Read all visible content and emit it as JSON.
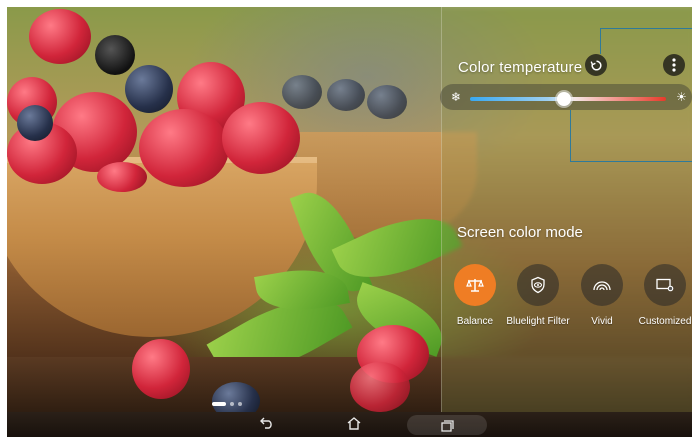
{
  "color_temperature": {
    "title": "Color temperature",
    "reset_icon": "refresh-icon",
    "menu_icon": "more-vert-icon",
    "cold_icon": "snowflake-icon",
    "warm_icon": "sun-icon",
    "slider_value": 0.48
  },
  "screen_color_mode": {
    "title": "Screen color mode",
    "modes": [
      {
        "label": "Balance",
        "icon": "scale-icon",
        "active": true
      },
      {
        "label": "Bluelight Filter",
        "icon": "eye-shield-icon",
        "active": false
      },
      {
        "label": "Vivid",
        "icon": "rainbow-icon",
        "active": false
      },
      {
        "label": "Customized",
        "icon": "custom-display-icon",
        "active": false
      }
    ]
  },
  "home_pages": {
    "count": 3,
    "current": 1
  },
  "navbar": {
    "back_icon": "back-icon",
    "home_icon": "home-icon",
    "recent_icon": "recent-apps-icon"
  },
  "colors": {
    "accent": "#ef7d24",
    "callout": "#2f7a9a"
  }
}
